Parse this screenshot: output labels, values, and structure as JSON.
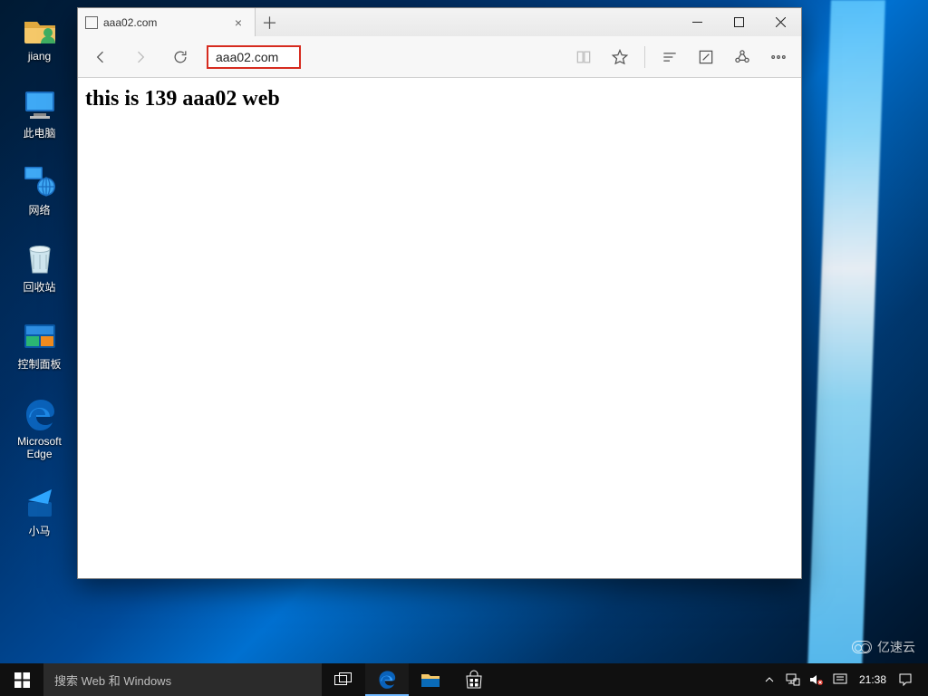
{
  "desktop_icons": [
    {
      "name": "user-folder",
      "label": "jiang"
    },
    {
      "name": "this-pc",
      "label": "此电脑"
    },
    {
      "name": "network",
      "label": "网络"
    },
    {
      "name": "recycle-bin",
      "label": "回收站"
    },
    {
      "name": "control-panel",
      "label": "控制面板"
    },
    {
      "name": "microsoft-edge",
      "label": "Microsoft\nEdge"
    },
    {
      "name": "xiaoma",
      "label": "小马"
    }
  ],
  "browser": {
    "tab_title": "aaa02.com",
    "address": "aaa02.com",
    "page_heading": "this is 139 aaa02 web"
  },
  "taskbar": {
    "search_placeholder": "搜索 Web 和 Windows",
    "clock_time": "21:38"
  },
  "watermark": "亿速云"
}
